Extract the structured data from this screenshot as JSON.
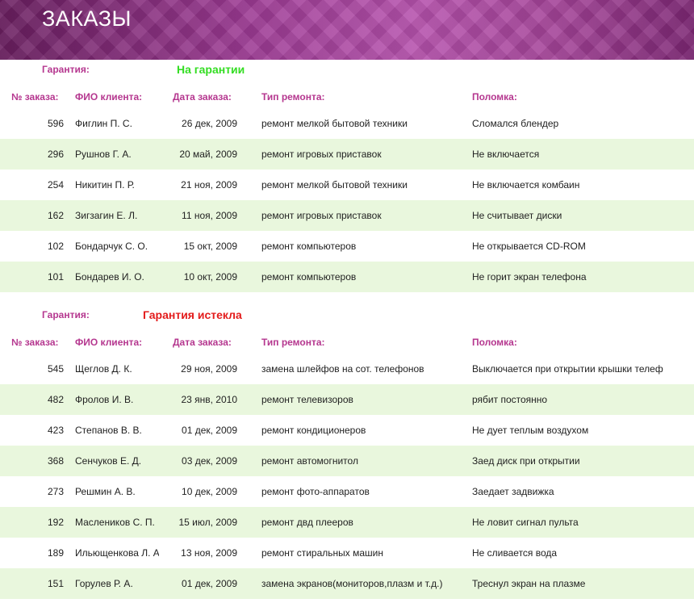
{
  "header": {
    "title": "ЗАКАЗЫ"
  },
  "columns": {
    "num": "№ заказа:",
    "name": "ФИО клиента:",
    "date": "Дата заказа:",
    "type": "Тип ремонта:",
    "fault": "Поломка:"
  },
  "sections": [
    {
      "warranty_label": "Гарантия:",
      "warranty_value": "На гарантии",
      "warranty_color": "#33dd22",
      "rows": [
        {
          "num": "596",
          "name": "Фиглин П. С.",
          "date": "26 дек, 2009",
          "type": "ремонт мелкой бытовой техники",
          "fault": "Сломался блендер"
        },
        {
          "num": "296",
          "name": "Рушнов Г. А.",
          "date": "20 май, 2009",
          "type": "ремонт игровых приставок",
          "fault": "Не включается"
        },
        {
          "num": "254",
          "name": "Никитин П. Р.",
          "date": "21 ноя, 2009",
          "type": "ремонт мелкой бытовой техники",
          "fault": "Не включается комбаин"
        },
        {
          "num": "162",
          "name": "Зигзагин Е. Л.",
          "date": "11 ноя, 2009",
          "type": "ремонт игровых приставок",
          "fault": "Не считывает диски"
        },
        {
          "num": "102",
          "name": "Бондарчук С. О.",
          "date": "15 окт, 2009",
          "type": "ремонт компьютеров",
          "fault": "Не открывается CD-ROM"
        },
        {
          "num": "101",
          "name": "Бондарев И. О.",
          "date": "10 окт, 2009",
          "type": "ремонт компьютеров",
          "fault": "Не горит экран телефона"
        }
      ]
    },
    {
      "warranty_label": "Гарантия:",
      "warranty_value": "Гарантия истекла",
      "warranty_color": "#e31b1b",
      "rows": [
        {
          "num": "545",
          "name": "Щеглов Д. К.",
          "date": "29 ноя, 2009",
          "type": "замена шлейфов на сот. телефонов",
          "fault": "Выключается при открытии крышки телеф"
        },
        {
          "num": "482",
          "name": "Фролов И. В.",
          "date": "23 янв, 2010",
          "type": "ремонт телевизоров",
          "fault": "рябит постоянно"
        },
        {
          "num": "423",
          "name": "Степанов В. В.",
          "date": "01 дек, 2009",
          "type": "ремонт кондиционеров",
          "fault": "Не дует теплым воздухом"
        },
        {
          "num": "368",
          "name": "Сенчуков Е. Д.",
          "date": "03 дек, 2009",
          "type": "ремонт автомогнитол",
          "fault": "Заед диск при открытии"
        },
        {
          "num": "273",
          "name": "Решмин А. В.",
          "date": "10 дек, 2009",
          "type": "ремонт фото-аппаратов",
          "fault": "Заедает задвижка"
        },
        {
          "num": "192",
          "name": "Маслеников С. П.",
          "date": "15 июл, 2009",
          "type": "ремонт двд плееров",
          "fault": "Не ловит сигнал пульта"
        },
        {
          "num": "189",
          "name": "Ильющенкова Л. А",
          "date": "13 ноя, 2009",
          "type": "ремонт стиральных машин",
          "fault": "Не сливается вода"
        },
        {
          "num": "151",
          "name": "Горулев Р. А.",
          "date": "01 дек, 2009",
          "type": "замена экранов(мониторов,плазм и т.д.)",
          "fault": "Треснул экран на плазме"
        }
      ]
    }
  ]
}
